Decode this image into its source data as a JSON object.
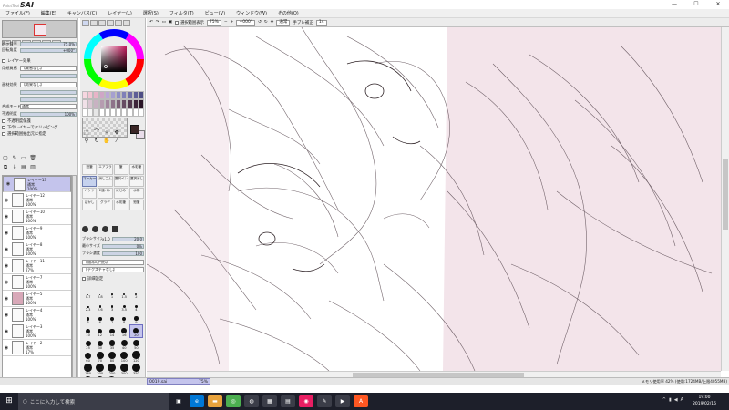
{
  "app": {
    "logo_small": "PaintTool",
    "logo_big": "SAI",
    "window_controls": [
      "—",
      "☐",
      "✕"
    ]
  },
  "menu": [
    "ファイル(F)",
    "編集(E)",
    "キャンバス(C)",
    "レイヤー(L)",
    "選択(S)",
    "フィルタ(T)",
    "ビュー(V)",
    "ウィンドウ(W)",
    "その他(O)"
  ],
  "navigator": {
    "zoom_label": "表示倍率",
    "zoom_value": "75.0%",
    "angle_label": "回転角度",
    "angle_value": "+000°"
  },
  "layer_props": {
    "effect_header": "レイヤー効果",
    "texture_label": "用紙質感",
    "texture_value": "【質感なし】",
    "effect_label": "画材効果",
    "effect_value": "【効果なし】",
    "blend_label": "合成モード",
    "blend_value": "通常",
    "opacity_label": "不透明度",
    "opacity_value": "100%",
    "clip_group": "下のレイヤーでクリッピング",
    "protect_opacity": "不透明度保護",
    "selection_source": "選択範囲抽出元に指定"
  },
  "layers": [
    {
      "name": "レイヤー13",
      "mode": "通常",
      "opacity": "100%"
    },
    {
      "name": "レイヤー12",
      "mode": "通常",
      "opacity": "100%"
    },
    {
      "name": "レイヤー10",
      "mode": "通常",
      "opacity": "100%"
    },
    {
      "name": "レイヤー9",
      "mode": "通常",
      "opacity": "100%"
    },
    {
      "name": "レイヤー8",
      "mode": "通常",
      "opacity": "100%"
    },
    {
      "name": "レイヤー11",
      "mode": "通常",
      "opacity": "27%"
    },
    {
      "name": "レイヤー7",
      "mode": "通常",
      "opacity": "100%"
    },
    {
      "name": "レイヤー5",
      "mode": "通常",
      "opacity": "100%"
    },
    {
      "name": "レイヤー4",
      "mode": "通常",
      "opacity": "100%"
    },
    {
      "name": "レイヤー3",
      "mode": "通常",
      "opacity": "100%"
    },
    {
      "name": "レイヤー2",
      "mode": "通常",
      "opacity": "17%"
    }
  ],
  "tools": {
    "items": [
      "鉛筆",
      "エアブラシ",
      "筆",
      "水彩筆",
      "マーカー",
      "消しゴム",
      "選択ペン",
      "選択消し",
      "バケツ",
      "2値ペン",
      "にじみ",
      "水彩",
      "ぼかし",
      "グラデ",
      "水彩筆",
      "鉛筆"
    ],
    "active_index": 4,
    "brush_size_label": "ブラシサイズ",
    "brush_size_mult": "x1.0",
    "brush_size_value": "20.0",
    "min_size_label": "最小サイズ",
    "min_size_value": "0%",
    "density_label": "ブラシ濃度",
    "density_value": "100",
    "shape_value": "【通常の円形】",
    "texture_value": "【テクスチャなし】",
    "detail_label": "詳細設定"
  },
  "brush_sizes": [
    "0.7",
    "0.8",
    "1",
    "1.5",
    "2",
    "2.3",
    "2.6",
    "3",
    "3.5",
    "4",
    "5",
    "6",
    "7",
    "8",
    "9",
    "10",
    "12",
    "14",
    "16",
    "20",
    "25",
    "30",
    "35",
    "40",
    "50",
    "60",
    "70",
    "80",
    "100",
    "120",
    "160",
    "200",
    "250",
    "300",
    "350",
    "400",
    "450",
    "500"
  ],
  "canvas_bar": {
    "selection_toggle": "選択範囲表示",
    "zoom": "75%",
    "angle": "+000°",
    "blend": "通常",
    "stabilizer_label": "手ブレ補正",
    "stabilizer_value": "14"
  },
  "file_tab": {
    "name": "0019.sai",
    "zoom": "75%"
  },
  "status": {
    "memory": "メモリ使用率 42% (使用:1724MB/上限4055MB)"
  },
  "taskbar": {
    "search_placeholder": "ここに入力して検索",
    "time": "19:00",
    "date": "2019/02/16"
  },
  "colors": {
    "accent": "#c4c4ec",
    "canvas_tint": "#f3e4ea",
    "taskbar": "#1d1f2a",
    "foreground_color": "#3a2626"
  }
}
